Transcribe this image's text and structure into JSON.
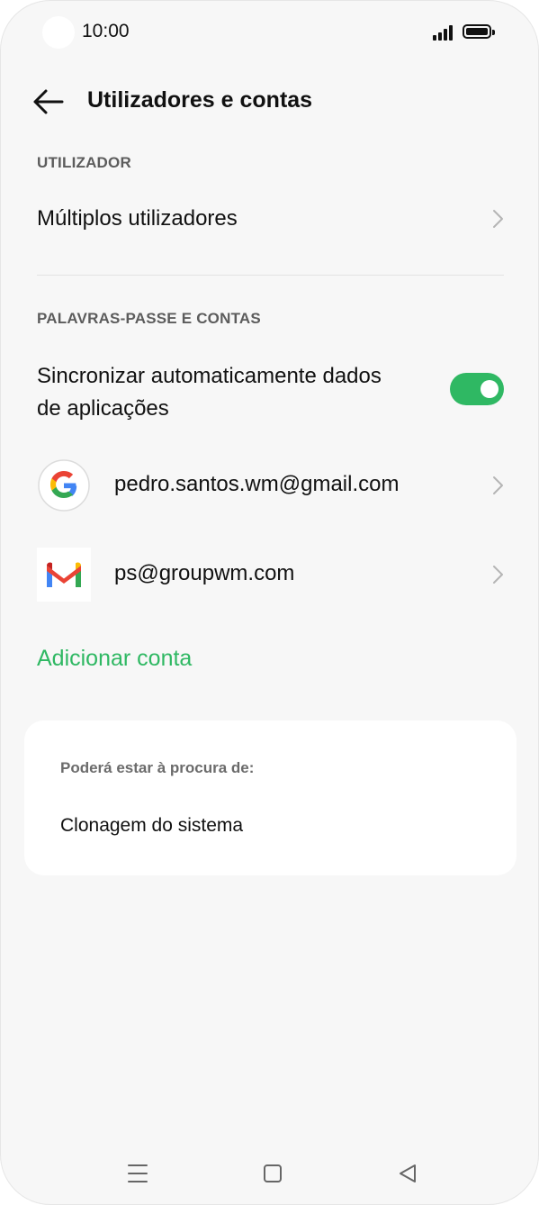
{
  "status_bar": {
    "time": "10:00"
  },
  "header": {
    "title": "Utilizadores e contas"
  },
  "sections": {
    "user_label": "UTILIZADOR",
    "accounts_label": "PALAVRAS-PASSE E CONTAS"
  },
  "multi_users": {
    "label": "Múltiplos utilizadores"
  },
  "auto_sync": {
    "line1": "Sincronizar automaticamente dados",
    "line2": "de aplicações",
    "enabled": true
  },
  "accounts": [
    {
      "icon": "google-icon",
      "email": "pedro.santos.wm@gmail.com"
    },
    {
      "icon": "gmail-icon",
      "email": "ps@groupwm.com"
    }
  ],
  "add_account": {
    "label": "Adicionar conta"
  },
  "suggestions": {
    "label": "Poderá estar à procura de:",
    "item": "Clonagem do sistema"
  },
  "colors": {
    "accent": "#2fb863",
    "background": "#f7f7f7"
  }
}
